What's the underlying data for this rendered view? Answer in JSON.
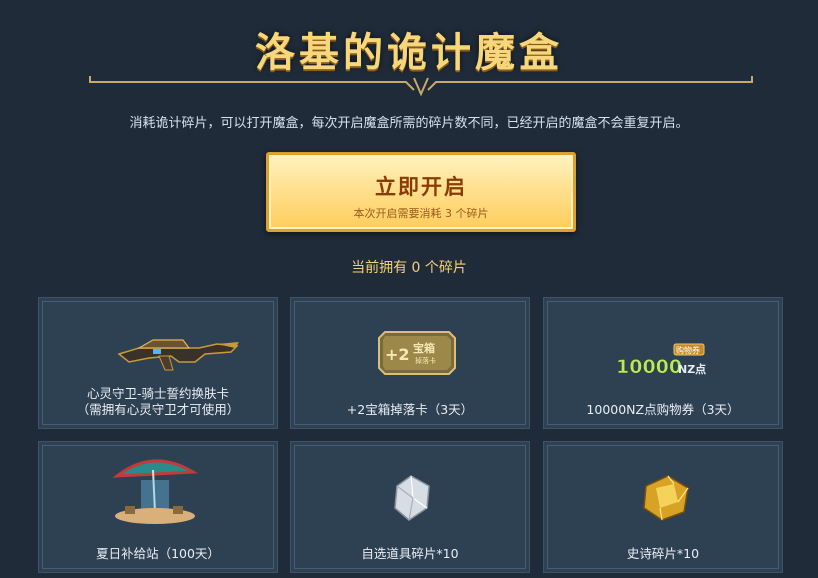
{
  "title": "洛基的诡计魔盒",
  "description": "消耗诡计碎片，可以打开魔盒，每次开启魔盒所需的碎片数不同，已经开启的魔盒不会重复开启。",
  "open_button": {
    "label": "立即开启",
    "sub": "本次开启需要消耗 3 个碎片"
  },
  "owned_text": "当前拥有 0 个碎片",
  "rewards": [
    {
      "label": "心灵守卫-骑士誓约换肤卡\n（需拥有心灵守卫才可使用）",
      "icon": "rifle-icon"
    },
    {
      "label": "+2宝箱掉落卡（3天）",
      "icon": "chest-card-icon",
      "badge_text": "+2",
      "badge_title": "宝箱",
      "badge_sub": "掉落卡"
    },
    {
      "label": "10000NZ点购物券（3天）",
      "icon": "voucher-icon",
      "voucher_amount": "10000",
      "voucher_unit": "NZ点",
      "voucher_tag": "购物券"
    },
    {
      "label": "夏日补给站（100天）",
      "icon": "umbrella-icon"
    },
    {
      "label": "自选道具碎片*10",
      "icon": "silver-shard-icon"
    },
    {
      "label": "史诗碎片*10",
      "icon": "gold-shard-icon"
    }
  ],
  "colors": {
    "background": "#1f2b38",
    "title_gold": "#f6d77c",
    "button_gold": "#ffe08f",
    "card_bg": "#2e4153"
  }
}
